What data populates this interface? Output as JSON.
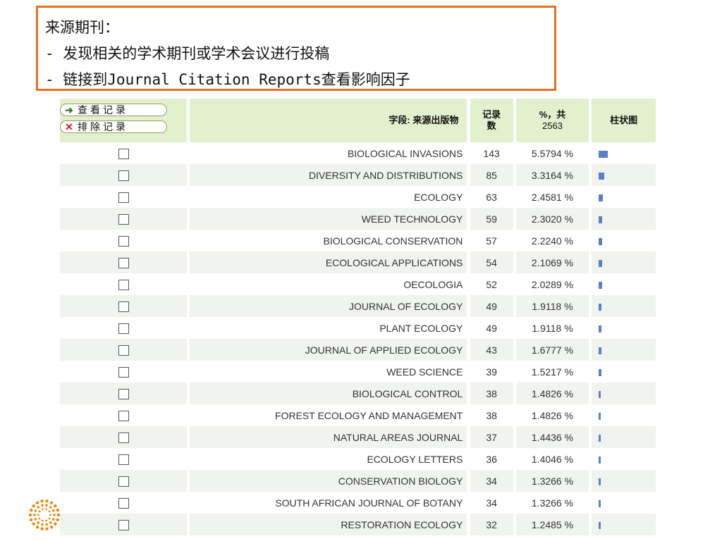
{
  "callout": {
    "lines": [
      "来源期刊：",
      "- 发现相关的学术期刊或学术会议进行投稿",
      "- 链接到Journal Citation Reports查看影响因子"
    ]
  },
  "actions": {
    "view_label": "查看记录",
    "exclude_label": "排除记录"
  },
  "table": {
    "headers": {
      "field": "字段: 来源出版物",
      "count_line1": "记录",
      "count_line2": "数",
      "percent_line1": "%，共",
      "percent_line2": "2563",
      "bar": "柱状图"
    },
    "bar_color": "#5b7fc7",
    "rows": [
      {
        "source": "BIOLOGICAL INVASIONS",
        "count": "143",
        "percent": "5.5794 %",
        "share": 5.5794
      },
      {
        "source": "DIVERSITY AND DISTRIBUTIONS",
        "count": "85",
        "percent": "3.3164 %",
        "share": 3.3164
      },
      {
        "source": "ECOLOGY",
        "count": "63",
        "percent": "2.4581 %",
        "share": 2.4581
      },
      {
        "source": "WEED TECHNOLOGY",
        "count": "59",
        "percent": "2.3020 %",
        "share": 2.302
      },
      {
        "source": "BIOLOGICAL CONSERVATION",
        "count": "57",
        "percent": "2.2240 %",
        "share": 2.224
      },
      {
        "source": "ECOLOGICAL APPLICATIONS",
        "count": "54",
        "percent": "2.1069 %",
        "share": 2.1069
      },
      {
        "source": "OECOLOGIA",
        "count": "52",
        "percent": "2.0289 %",
        "share": 2.0289
      },
      {
        "source": "JOURNAL OF ECOLOGY",
        "count": "49",
        "percent": "1.9118 %",
        "share": 1.9118
      },
      {
        "source": "PLANT ECOLOGY",
        "count": "49",
        "percent": "1.9118 %",
        "share": 1.9118
      },
      {
        "source": "JOURNAL OF APPLIED ECOLOGY",
        "count": "43",
        "percent": "1.6777 %",
        "share": 1.6777
      },
      {
        "source": "WEED SCIENCE",
        "count": "39",
        "percent": "1.5217 %",
        "share": 1.5217
      },
      {
        "source": "BIOLOGICAL CONTROL",
        "count": "38",
        "percent": "1.4826 %",
        "share": 1.4826
      },
      {
        "source": "FOREST ECOLOGY AND MANAGEMENT",
        "count": "38",
        "percent": "1.4826 %",
        "share": 1.4826
      },
      {
        "source": "NATURAL AREAS JOURNAL",
        "count": "37",
        "percent": "1.4436 %",
        "share": 1.4436
      },
      {
        "source": "ECOLOGY LETTERS",
        "count": "36",
        "percent": "1.4046 %",
        "share": 1.4046
      },
      {
        "source": "CONSERVATION BIOLOGY",
        "count": "34",
        "percent": "1.3266 %",
        "share": 1.3266
      },
      {
        "source": "SOUTH AFRICAN JOURNAL OF BOTANY",
        "count": "34",
        "percent": "1.3266 %",
        "share": 1.3266
      },
      {
        "source": "RESTORATION ECOLOGY",
        "count": "32",
        "percent": "1.2485 %",
        "share": 1.2485
      }
    ]
  }
}
